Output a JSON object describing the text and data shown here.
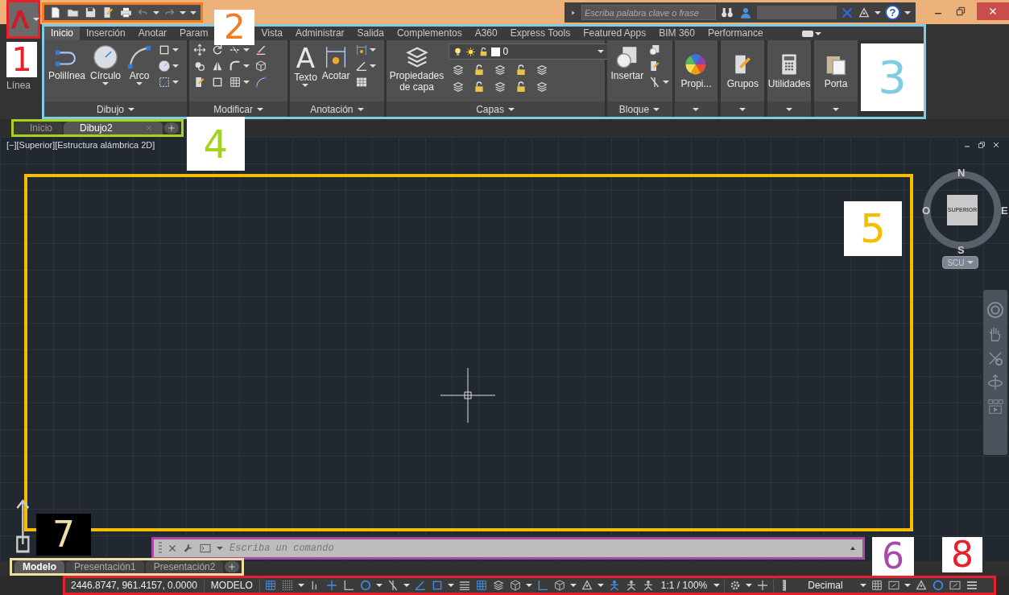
{
  "callouts": [
    {
      "label": "1",
      "color": "#e8202a",
      "dark": false
    },
    {
      "label": "2",
      "color": "#f47b20",
      "dark": false
    },
    {
      "label": "3",
      "color": "#7fcde3",
      "dark": false
    },
    {
      "label": "4",
      "color": "#a3d31c",
      "dark": false
    },
    {
      "label": "5",
      "color": "#f5bd00",
      "dark": false
    },
    {
      "label": "6",
      "color": "#a64ca6",
      "dark": false
    },
    {
      "label": "7",
      "color": "#efdfa5",
      "dark": true
    },
    {
      "label": "8",
      "color": "#e8202a",
      "dark": false
    }
  ],
  "search": {
    "placeholder": "Escriba palabra clave o frase"
  },
  "help": {
    "label": "?"
  },
  "ribbon": {
    "first_button": {
      "label": "Línea"
    },
    "tabs": [
      {
        "label": "Inicio",
        "selected": true
      },
      {
        "label": "Inserción",
        "selected": false
      },
      {
        "label": "Anotar",
        "selected": false
      },
      {
        "label": "Param",
        "selected": false
      },
      {
        "label": "Vista",
        "selected": false
      },
      {
        "label": "Administrar",
        "selected": false
      },
      {
        "label": "Salida",
        "selected": false
      },
      {
        "label": "Complementos",
        "selected": false
      },
      {
        "label": "A360",
        "selected": false
      },
      {
        "label": "Express Tools",
        "selected": false
      },
      {
        "label": "Featured Apps",
        "selected": false
      },
      {
        "label": "BIM 360",
        "selected": false
      },
      {
        "label": "Performance",
        "selected": false
      }
    ],
    "panels": [
      {
        "kind": "tools",
        "title": "Dibujo",
        "large": [
          {
            "label": "Polilínea",
            "dropdown": false
          },
          {
            "label": "Círculo",
            "dropdown": true
          },
          {
            "label": "Arco",
            "dropdown": true
          }
        ]
      },
      {
        "kind": "tools",
        "title": "Modificar"
      },
      {
        "kind": "tools",
        "title": "Anotación",
        "large": [
          {
            "label": "Texto",
            "glyph": "A",
            "dropdown": true
          },
          {
            "label": "Acotar",
            "dropdown": false
          }
        ]
      },
      {
        "kind": "layers",
        "title": "Capas",
        "large": [
          {
            "label": "Propiedades de capa",
            "dropdown": false
          }
        ],
        "layer": "0"
      },
      {
        "kind": "tools",
        "title": "Bloque",
        "large": [
          {
            "label": "Insertar",
            "dropdown": false
          }
        ]
      },
      {
        "kind": "flyout",
        "label": "Propi..."
      },
      {
        "kind": "flyout",
        "label": "Grupos"
      },
      {
        "kind": "flyout",
        "label": "Utilidades"
      },
      {
        "kind": "flyout",
        "label": "Porta"
      }
    ]
  },
  "file_tabs": [
    {
      "label": "Inicio",
      "selected": false
    },
    {
      "label": "Dibujo2",
      "selected": true
    }
  ],
  "viewport": {
    "label": "[−][Superior][Estructura alámbrica 2D]",
    "viewcube": {
      "face": "SUPERIOR",
      "north": "N",
      "south": "S",
      "east": "E",
      "west": "O",
      "ucs": "SCU"
    }
  },
  "command_line": {
    "placeholder": "Escriba un comando"
  },
  "layout_tabs": [
    {
      "label": "Modelo",
      "selected": true
    },
    {
      "label": "Presentación1",
      "selected": false
    },
    {
      "label": "Presentación2",
      "selected": false
    }
  ],
  "status_bar": {
    "coordinates": "2446.8747, 961.4157, 0.0000",
    "space": "MODELO",
    "scale": "1:1 / 100%",
    "units": "Decimal",
    "toggles": [
      {
        "on": true
      },
      {
        "on": false
      },
      {
        "on": false
      },
      {
        "on": true
      },
      {
        "on": false
      },
      {
        "on": true
      },
      {
        "on": false
      },
      {
        "on": true
      },
      {
        "on": true
      },
      {
        "on": false
      },
      {
        "on": true
      },
      {
        "on": false
      },
      {
        "on": false
      },
      {
        "on": true
      },
      {
        "on": false
      },
      {
        "on": false
      },
      {
        "on": true
      },
      {
        "on": false
      },
      {
        "on": false
      }
    ],
    "tail_toggles": [
      {
        "on": false
      },
      {
        "on": false
      },
      {
        "on": false
      },
      {
        "on": true
      },
      {
        "on": false
      }
    ]
  }
}
